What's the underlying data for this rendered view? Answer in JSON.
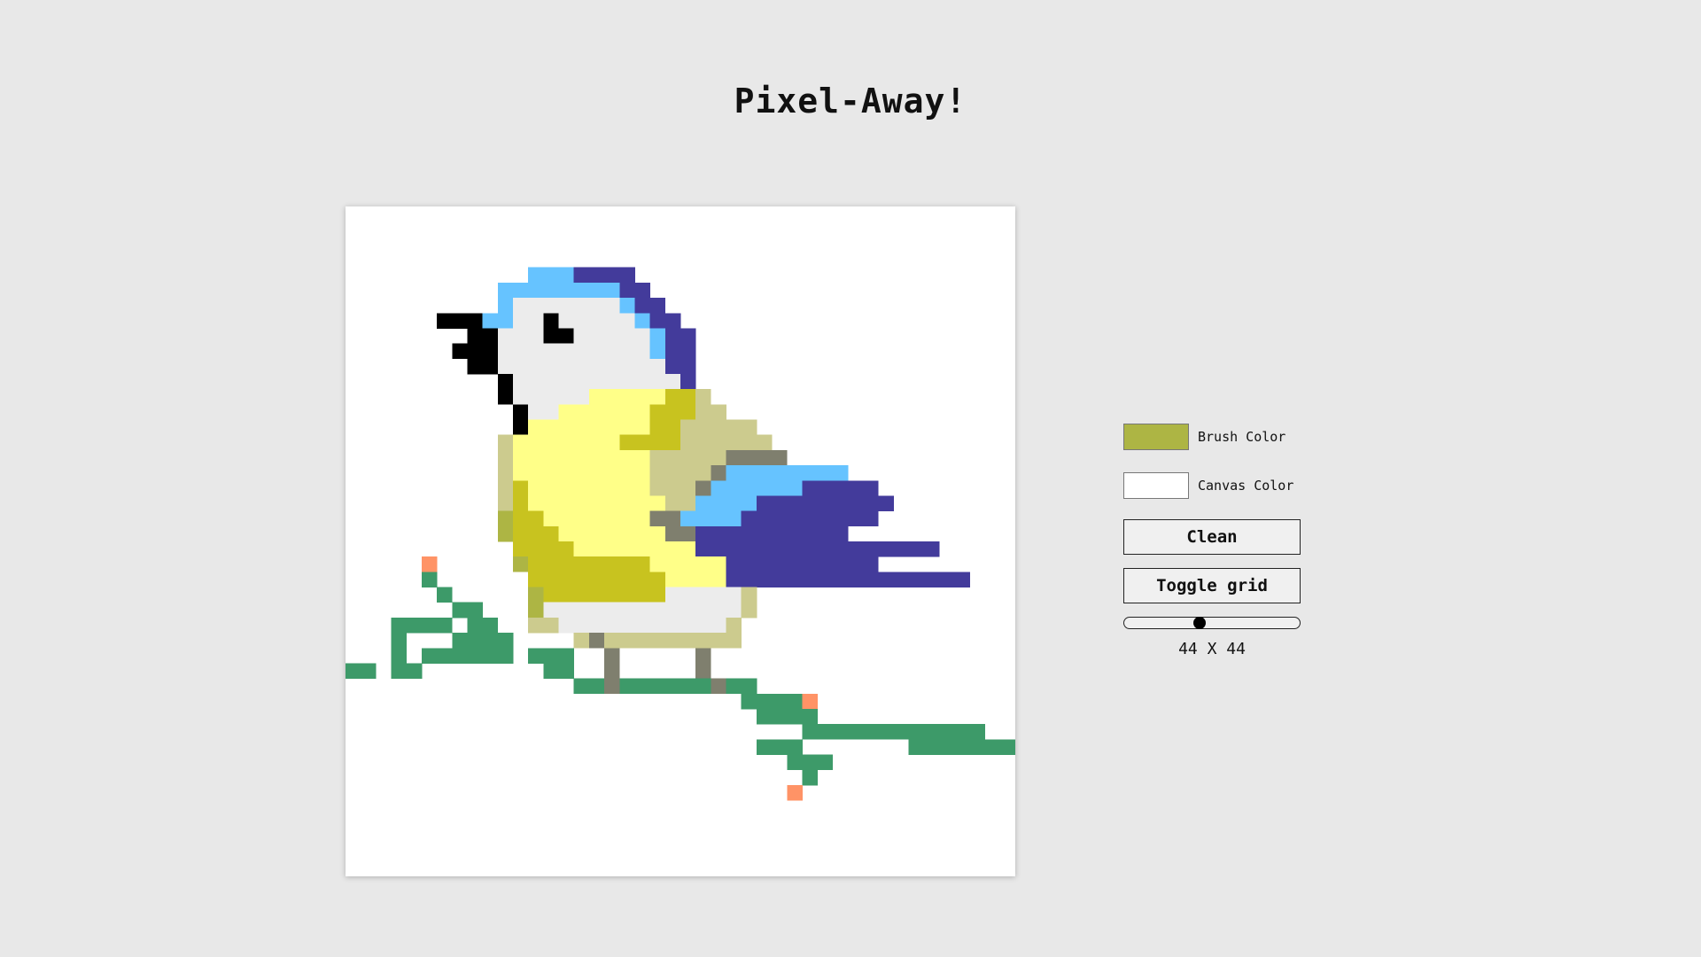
{
  "app": {
    "title": "Pixel-Away!"
  },
  "controls": {
    "brush_color_label": "Brush Color",
    "brush_color": "#adb544",
    "canvas_color_label": "Canvas Color",
    "canvas_color": "#ffffff",
    "clean_label": "Clean",
    "toggle_grid_label": "Toggle grid",
    "slider_level": 0.43,
    "size_label": "44 X 44"
  },
  "canvas": {
    "grid_size": 44,
    "palette": {
      "k": "#000000",
      "W": "#ececec",
      "b": "#66c3ff",
      "p": "#433b9b",
      "Y": "#ffff88",
      "y": "#c8c31f",
      "o": "#adb544",
      "t": "#cccb8e",
      "g": "#7f7f6e",
      "G": "#3d9a69",
      "r": "#ff9366"
    },
    "rows": [
      "............................................",
      "............................................",
      "............................................",
      "............................................",
      "............bbbpppp.........................",
      "..........bbbbbbbbpp........................",
      "..........bWWWWWWWbpp.......................",
      "......kkkbbWWkWWWWWbpp......................",
      "........kkWWWkkWWWWWbpp.....................",
      ".......kkkWWWWWWWWWWbpp.....................",
      "........kkWWWWWWWWWWWpp.....................",
      "..........kWWWWWWWWWWWp.....................",
      "..........kWWWWWYYYYYyyt....................",
      "...........kWWYYYYYYyyytt...................",
      "...........kYYYYYYYYyyttttt.................",
      "..........tYYYYYYYyyyytttttt................",
      "..........tYYYYYYYYYtttttgggg...............",
      "..........tYYYYYYYYYttttgbbbbbbbb...........",
      "..........tyYYYYYYYYtttgbbbbbbppppp.........",
      "..........tyYYYYYYYYYttbbbbppppppppp........",
      "..........oyyYYYYYYYggbbbbppppppppp.........",
      "..........oyyyYYYYYYYggpppppppppp...........",
      "...........yyyyYYYYYYYYpppppppppppppppp.....",
      ".....r.....oyyyyyyyyYYYYYpppppppppp.........",
      ".....G......yyyyyyyyyYYYYpppppppppppppppp...",
      "......G.....oyyyyyyyyWWWWWt.................",
      ".......GG...oWWWWWWWWWWWWWt.................",
      "...GGGG.GG..ttWWWWWWWWWWWt..................",
      "...G...GGGG....tgttttttttt..................",
      "...G.GGGGGG.GGG..g.....g....................",
      "GG.GG........GG..g.....g....................",
      "...............GGgGGGGGGgGG.................",
      "..........................GGGGr.............",
      "...........................GGGG.............",
      "..............................GGGGGGGGGGGG..",
      "...........................GGG.......GGGGGGG",
      ".............................GGG............",
      "..............................G.............",
      ".............................r..............",
      "............................................",
      "............................................",
      "............................................",
      "............................................",
      "............................................"
    ]
  }
}
